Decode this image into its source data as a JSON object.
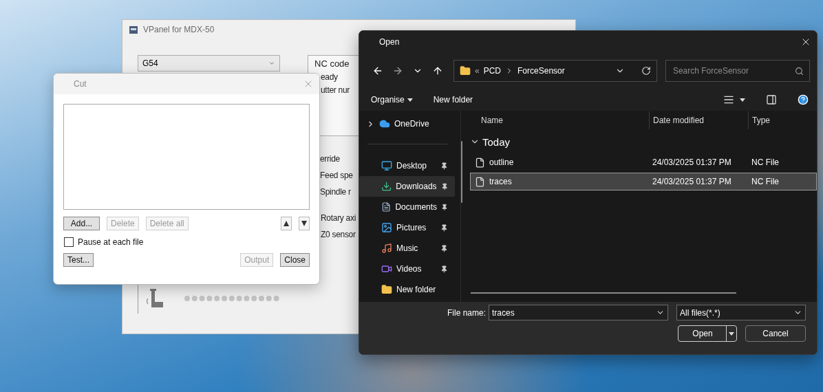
{
  "vpanel": {
    "title": "VPanel for MDX-50",
    "coordinate_select": "G54",
    "status_lines": [
      "NC code",
      "eady",
      "utter nur"
    ],
    "override_lines": [
      "erride",
      "Feed spe",
      "Spindle r"
    ],
    "option_lines": [
      "Rotary axi",
      "Z0 sensor"
    ]
  },
  "cut_dialog": {
    "title": "Cut",
    "list_buttons": [
      {
        "label": "Add...",
        "disabled": false
      },
      {
        "label": "Delete",
        "disabled": true
      },
      {
        "label": "Delete all",
        "disabled": true
      }
    ],
    "pause_checkbox": {
      "label": "Pause at each file",
      "checked": false
    },
    "left_buttons": [
      {
        "label": "Test...",
        "disabled": false
      }
    ],
    "right_buttons": [
      {
        "label": "Output",
        "disabled": true
      },
      {
        "label": "Close",
        "disabled": false
      }
    ]
  },
  "open_dialog": {
    "title": "Open",
    "breadcrumb": {
      "overflow": "«",
      "segments": [
        "PCD",
        "ForceSensor"
      ]
    },
    "search": {
      "placeholder": "Search ForceSensor"
    },
    "toolbar": [
      {
        "label": "Organise",
        "dropdown": true
      },
      {
        "label": "New folder",
        "dropdown": false
      }
    ],
    "sidebar": {
      "top": [
        {
          "label": "OneDrive",
          "expandable": true
        }
      ],
      "items": [
        {
          "label": "Desktop",
          "pinned": true,
          "selected": false
        },
        {
          "label": "Downloads",
          "pinned": true,
          "selected": true
        },
        {
          "label": "Documents",
          "pinned": true,
          "selected": false
        },
        {
          "label": "Pictures",
          "pinned": true,
          "selected": false
        },
        {
          "label": "Music",
          "pinned": true,
          "selected": false
        },
        {
          "label": "Videos",
          "pinned": true,
          "selected": false
        },
        {
          "label": "New folder",
          "pinned": false,
          "selected": false
        }
      ]
    },
    "columns": [
      "Name",
      "Date modified",
      "Type"
    ],
    "groups": [
      {
        "label": "Today",
        "expanded": true,
        "files": [
          {
            "name": "outline",
            "modified": "24/03/2025 01:37 PM",
            "type": "NC File",
            "selected": false
          },
          {
            "name": "traces",
            "modified": "24/03/2025 01:37 PM",
            "type": "NC File",
            "selected": true
          }
        ]
      }
    ],
    "file_name": {
      "label": "File name:",
      "value": "traces"
    },
    "file_type": {
      "value": "All files(*.*)"
    },
    "buttons": [
      {
        "label": "Open",
        "kind": "split"
      },
      {
        "label": "Cancel",
        "kind": "plain"
      }
    ]
  }
}
